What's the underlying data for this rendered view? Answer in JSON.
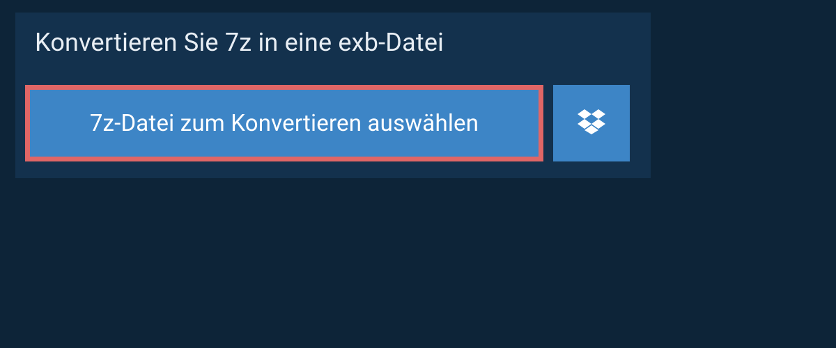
{
  "header": {
    "title": "Konvertieren Sie 7z in eine exb-Datei"
  },
  "actions": {
    "select_file_label": "7z-Datei zum Konvertieren auswählen"
  },
  "icons": {
    "dropbox": "dropbox-icon"
  },
  "colors": {
    "background": "#0d2438",
    "panel": "#13314d",
    "button": "#3d85c6",
    "highlight_border": "#e06666",
    "text_light": "#e8eef4",
    "text_button": "#ffffff"
  }
}
